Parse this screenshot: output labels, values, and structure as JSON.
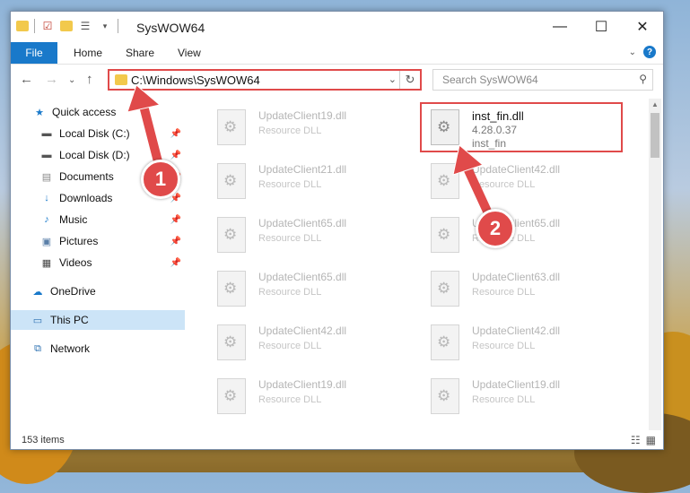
{
  "window": {
    "title": "SysWOW64",
    "controls": {
      "minimize": "—",
      "maximize": "☐",
      "close": "✕"
    }
  },
  "ribbon": {
    "tabs": [
      "File",
      "Home",
      "Share",
      "View"
    ],
    "expand_icon": "chevron-down-icon",
    "help": "?"
  },
  "navigation": {
    "address_path": "C:\\Windows\\SysWOW64",
    "search_placeholder": "Search SysWOW64"
  },
  "sidebar": {
    "items": [
      {
        "label": "Quick access",
        "icon": "star-icon",
        "pinned": false
      },
      {
        "label": "Local Disk (C:)",
        "icon": "drive-icon",
        "pinned": true
      },
      {
        "label": "Local Disk (D:)",
        "icon": "drive-icon",
        "pinned": true
      },
      {
        "label": "Documents",
        "icon": "documents-icon",
        "pinned": true
      },
      {
        "label": "Downloads",
        "icon": "download-icon",
        "pinned": true
      },
      {
        "label": "Music",
        "icon": "music-icon",
        "pinned": true
      },
      {
        "label": "Pictures",
        "icon": "pictures-icon",
        "pinned": true
      },
      {
        "label": "Videos",
        "icon": "videos-icon",
        "pinned": true
      },
      {
        "label": "OneDrive",
        "icon": "cloud-icon",
        "pinned": false
      },
      {
        "label": "This PC",
        "icon": "computer-icon",
        "pinned": false,
        "selected": true
      },
      {
        "label": "Network",
        "icon": "network-icon",
        "pinned": false
      }
    ]
  },
  "files": {
    "highlighted": {
      "name": "inst_fin.dll",
      "version": "4.28.0.37",
      "description": "inst_fin"
    },
    "left_column": [
      {
        "name": "UpdateClient19.dll",
        "description": "Resource DLL"
      },
      {
        "name": "UpdateClient21.dll",
        "description": "Resource DLL"
      },
      {
        "name": "UpdateClient65.dll",
        "description": "Resource DLL"
      },
      {
        "name": "UpdateClient65.dll",
        "description": "Resource DLL"
      },
      {
        "name": "UpdateClient42.dll",
        "description": "Resource DLL"
      },
      {
        "name": "UpdateClient19.dll",
        "description": "Resource DLL"
      }
    ],
    "right_column": [
      {
        "name": "UpdateClient42.dll",
        "description": "Resource DLL"
      },
      {
        "name": "UpdateClient65.dll",
        "description": "Resource DLL"
      },
      {
        "name": "UpdateClient63.dll",
        "description": "Resource DLL"
      },
      {
        "name": "UpdateClient42.dll",
        "description": "Resource DLL"
      },
      {
        "name": "UpdateClient19.dll",
        "description": "Resource DLL"
      }
    ]
  },
  "status": {
    "item_count": "153 items"
  },
  "annotations": {
    "step1": "1",
    "step2": "2",
    "color": "#e04a4a"
  }
}
